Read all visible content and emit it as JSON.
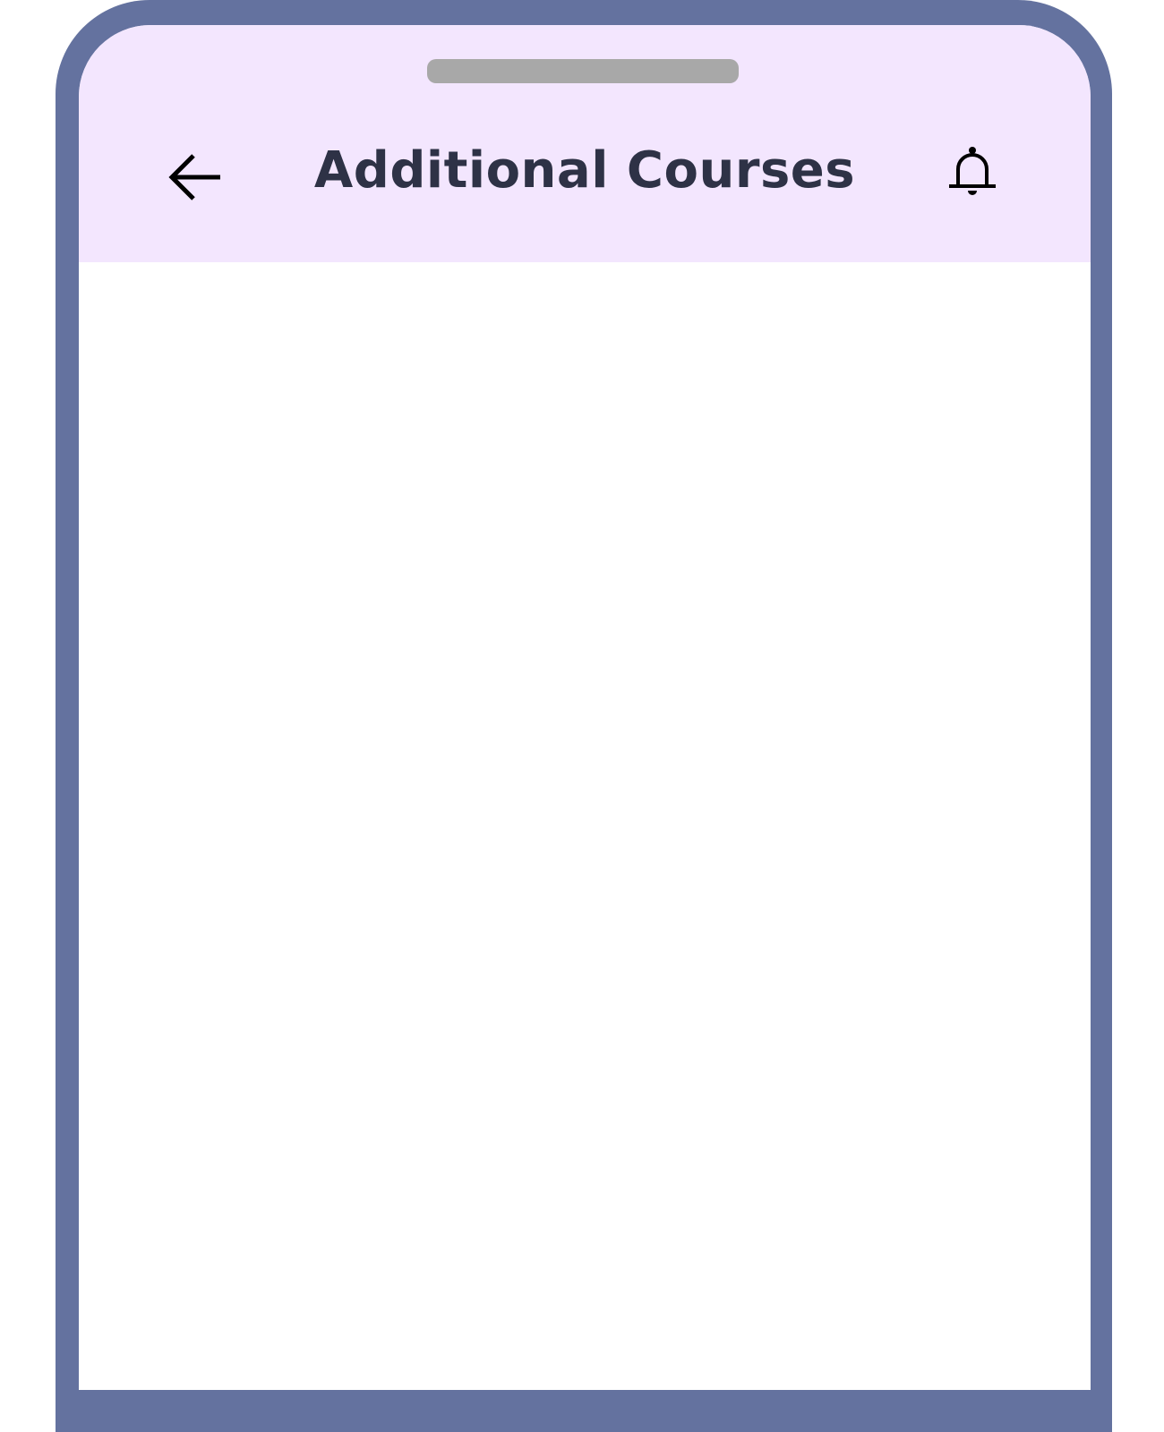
{
  "header": {
    "title": "Additional Courses",
    "back_icon": "arrow-left-icon",
    "notification_icon": "bell-icon",
    "background": "#f3e6fe",
    "title_color": "#2e3246"
  },
  "device": {
    "frame_color": "#64729f"
  }
}
